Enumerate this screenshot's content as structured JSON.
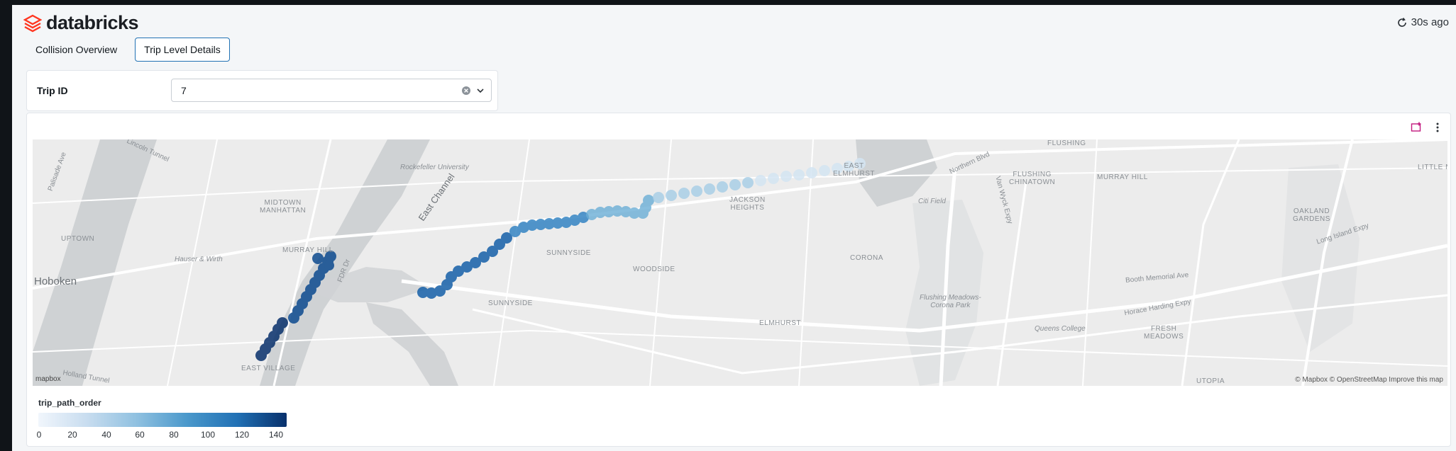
{
  "app": {
    "brand": "databricks",
    "refresh_text": "30s ago"
  },
  "tabs": [
    {
      "label": "Collision Overview",
      "active": false
    },
    {
      "label": "Trip Level Details",
      "active": true
    }
  ],
  "filter": {
    "label": "Trip ID",
    "value": "7"
  },
  "map": {
    "labels": {
      "hoboken": "Hoboken",
      "uptown": "UPTOWN",
      "midtown": "MIDTOWN\nMANHATTAN",
      "murray_hill": "MURRAY HILL",
      "east_village": "EAST VILLAGE",
      "sunnyside": "SUNNYSIDE",
      "sunnyside2": "SUNNYSIDE",
      "woodside": "WOODSIDE",
      "jackson_heights": "JACKSON\nHEIGHTS",
      "corona": "CORONA",
      "elmhurst": "ELMHURST",
      "east_elmhurst": "EAST\nELMHURST",
      "flushing": "FLUSHING",
      "flushing_chinatown": "FLUSHING\nCHINATOWN",
      "murray_hill_q": "MURRAY HILL",
      "oakland_gardens": "OAKLAND\nGARDENS",
      "fresh_meadows": "FRESH\nMEADOWS",
      "utopia": "UTOPIA",
      "little_neck": "LITTLE N",
      "citi_field": "Citi Field",
      "flushing_meadows": "Flushing Meadows-\nCorona Park",
      "queens_college": "Queens College",
      "rockefeller": "Rockefeller University",
      "east_channel": "East Channel",
      "hauser": "Hauser & Wirth",
      "lincoln_tunnel": "Lincoln Tunnel",
      "holland_tunnel": "Holland Tunnel",
      "palisade": "Palisade Ave",
      "northern_blvd": "Northern Blvd",
      "long_island_expy": "Long Island Expy",
      "booth_memorial": "Booth Memorial Ave",
      "horace_harding": "Horace Harding Expy",
      "fdr": "FDR Dr",
      "van_wyck": "Van Wyck Expy"
    },
    "attribution": "© Mapbox © OpenStreetMap Improve this map",
    "mapbox_logo": "mapbox"
  },
  "legend": {
    "title": "trip_path_order",
    "ticks": [
      "0",
      "20",
      "40",
      "60",
      "80",
      "100",
      "120",
      "140"
    ],
    "colors": [
      "#f1f6fc",
      "#c7dcef",
      "#8ec0e0",
      "#4a98cb",
      "#2171b5",
      "#08306b"
    ]
  },
  "icons": {
    "logo": "databricks-logo-icon",
    "refresh": "refresh-icon",
    "clear": "clear-icon",
    "chevron": "chevron-down-icon",
    "add_chart": "add-visualization-icon",
    "kebab": "kebab-menu-icon"
  }
}
